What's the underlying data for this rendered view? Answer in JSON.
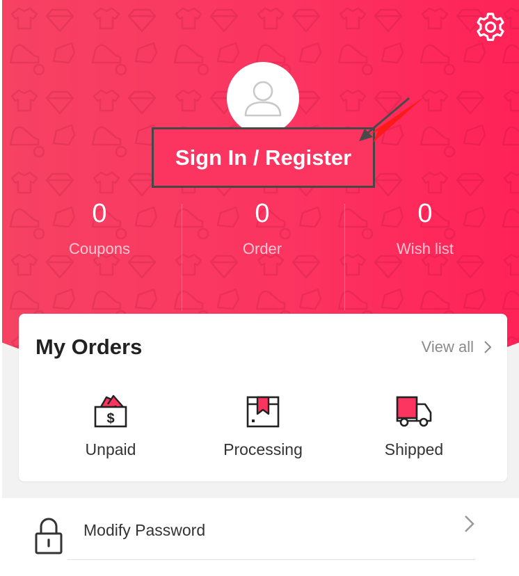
{
  "profile": {
    "sign_in_label": "Sign In / Register"
  },
  "stats": [
    {
      "value": "0",
      "label": "Coupons"
    },
    {
      "value": "0",
      "label": "Order"
    },
    {
      "value": "0",
      "label": "Wish list"
    }
  ],
  "orders": {
    "title": "My Orders",
    "view_all_label": "View all",
    "items": [
      {
        "label": "Unpaid",
        "icon": "unpaid-wallet-icon"
      },
      {
        "label": "Processing",
        "icon": "processing-box-icon"
      },
      {
        "label": "Shipped",
        "icon": "shipped-truck-icon"
      }
    ]
  },
  "menu": [
    {
      "label": "Modify Password",
      "icon": "lock-icon"
    }
  ],
  "colors": {
    "accent": "#fb3460",
    "accent_light": "#f64263",
    "accent_dark": "#ff2257",
    "page_bg": "#f2f2f2",
    "annotation_arrow": "#ff1a1a"
  }
}
